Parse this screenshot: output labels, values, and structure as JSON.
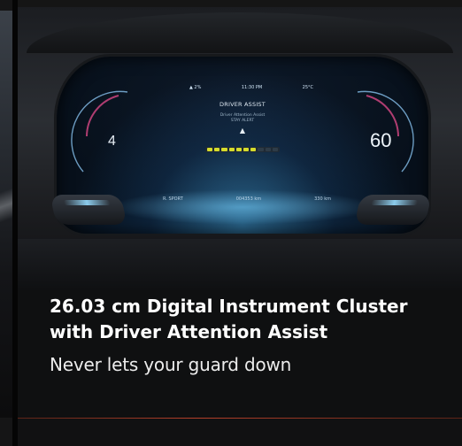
{
  "card": {
    "title_line1": "26.03 cm Digital Instrument Cluster",
    "title_line2": "with Driver Attention Assist",
    "subtitle": "Never lets your guard down"
  },
  "cluster": {
    "status_left": "▲ 2%",
    "status_time": "11:30 PM",
    "status_temp": "25°C",
    "screen_title": "DRIVER ASSIST",
    "screen_sub1": "Driver Attention Assist",
    "screen_sub2": "STAY ALERT",
    "gear": "4",
    "speed": "60",
    "attention_level": 0.7,
    "odometer": "004353 km",
    "range": "330 km",
    "mode": "R. SPORT"
  },
  "colors": {
    "title": "#ffffff",
    "accent": "#b5402a",
    "screen_glow": "#46aae6",
    "attention_bar": "#d6dc2c"
  }
}
